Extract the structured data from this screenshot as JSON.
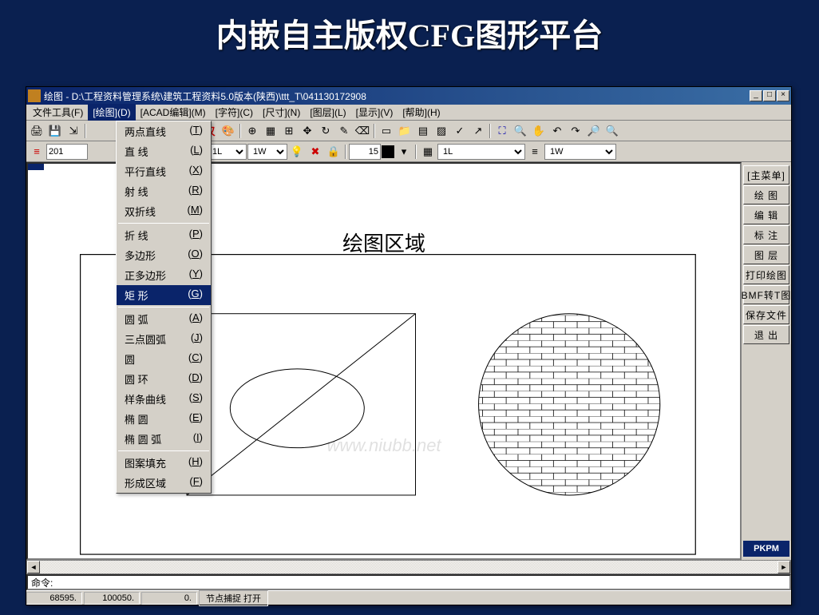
{
  "slide": {
    "title": "内嵌自主版权CFG图形平台"
  },
  "window": {
    "title": "绘图 - D:\\工程资料管理系统\\建筑工程资料5.0版本(陕西)\\ttt_T\\041130172908",
    "controls": {
      "min": "_",
      "max": "□",
      "close": "×"
    }
  },
  "menubar": [
    {
      "label": "文件工具(F)",
      "key": "file"
    },
    {
      "label": "[绘图](D)",
      "key": "draw",
      "active": true
    },
    {
      "label": "[ACAD编辑](M)",
      "key": "acad"
    },
    {
      "label": "[字符](C)",
      "key": "char"
    },
    {
      "label": "[尺寸](N)",
      "key": "dim"
    },
    {
      "label": "[图层](L)",
      "key": "layer"
    },
    {
      "label": "[显示](V)",
      "key": "view"
    },
    {
      "label": "[帮助](H)",
      "key": "help"
    }
  ],
  "dropdown": {
    "items": [
      {
        "label": "两点直线",
        "sc": "T"
      },
      {
        "label": "直   线",
        "sc": "L"
      },
      {
        "label": "平行直线",
        "sc": "X"
      },
      {
        "label": "射   线",
        "sc": "R"
      },
      {
        "label": "双折线",
        "sc": "M"
      },
      {
        "sep": true
      },
      {
        "label": "折   线",
        "sc": "P"
      },
      {
        "label": "多边形",
        "sc": "O"
      },
      {
        "label": "正多边形",
        "sc": "Y"
      },
      {
        "label": "矩   形",
        "sc": "G",
        "highlighted": true
      },
      {
        "sep": true
      },
      {
        "label": "圆   弧",
        "sc": "A"
      },
      {
        "label": "三点圆弧",
        "sc": "J"
      },
      {
        "label": "圆",
        "sc": "C"
      },
      {
        "label": "圆   环",
        "sc": "D"
      },
      {
        "label": "样条曲线",
        "sc": "S"
      },
      {
        "label": "椭   圆",
        "sc": "E"
      },
      {
        "label": "椭 圆 弧",
        "sc": "I"
      },
      {
        "sep": true
      },
      {
        "label": "图案填充",
        "sc": "H"
      },
      {
        "label": "形成区域",
        "sc": "F"
      }
    ]
  },
  "toolbar2": {
    "combo1": "201",
    "combo2": "1L",
    "combo3": "1W",
    "num1": "15",
    "combo4": "1L",
    "combo5": "1W"
  },
  "sidebar": [
    {
      "label": "[主菜单]"
    },
    {
      "label": "绘    图"
    },
    {
      "label": "编    辑"
    },
    {
      "label": "标    注"
    },
    {
      "label": "图    层"
    },
    {
      "label": "打印绘图"
    },
    {
      "label": "BMF转T图"
    },
    {
      "label": "保存文件"
    },
    {
      "label": "退    出"
    }
  ],
  "logo": "PKPM",
  "canvas": {
    "label": "绘图区域",
    "watermark": "www.niubb.net"
  },
  "cmdline": "命令:",
  "statusbar": {
    "x": "68595.",
    "y": "100050.",
    "z": "0.",
    "snap": "节点捕捉 打开"
  },
  "colors": {
    "titlebar_start": "#0a246a",
    "titlebar_end": "#3a6ea5",
    "panel": "#d4d0c8",
    "highlight": "#0a246a"
  }
}
